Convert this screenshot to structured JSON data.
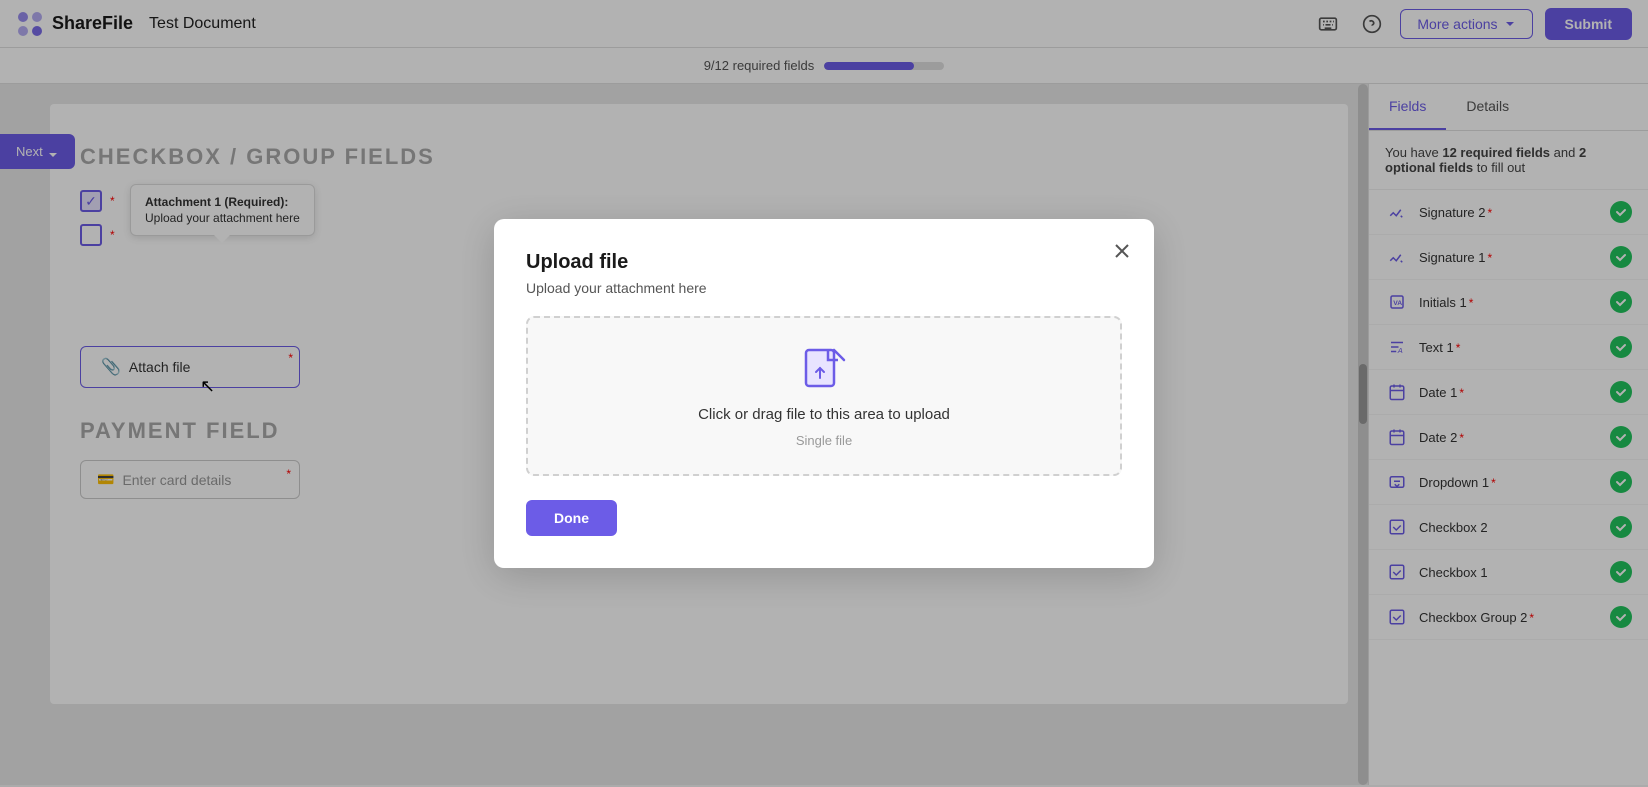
{
  "header": {
    "logo_text": "ShareFile",
    "doc_title": "Test Document",
    "more_actions_label": "More actions",
    "submit_label": "Submit"
  },
  "progress": {
    "text": "9/12 required fields",
    "percent": 75
  },
  "document": {
    "section_title": "CHECKBOX / GROUP FIELDS",
    "next_button_label": "Next",
    "tooltip_title": "Attachment 1 (Required):",
    "tooltip_body": "Upload your attachment here",
    "attach_file_label": "Attach file",
    "payment_section_title": "PAYMENT FIELD",
    "card_input_placeholder": "Enter card details"
  },
  "right_panel": {
    "tab_fields": "Fields",
    "tab_details": "Details",
    "info_text_prefix": "You have ",
    "required_count": "12 required fields",
    "info_text_middle": " and ",
    "optional_count": "2 optional fields",
    "info_text_suffix": " to fill out",
    "fields": [
      {
        "id": "signature2",
        "icon": "✏",
        "name": "Signature 2",
        "required": true,
        "done": true
      },
      {
        "id": "signature1",
        "icon": "✏",
        "name": "Signature 1",
        "required": true,
        "done": true
      },
      {
        "id": "initials1",
        "icon": "VA",
        "name": "Initials 1",
        "required": true,
        "done": true
      },
      {
        "id": "text1",
        "icon": "A",
        "name": "Text 1",
        "required": true,
        "done": true
      },
      {
        "id": "date1",
        "icon": "📅",
        "name": "Date 1",
        "required": true,
        "done": true
      },
      {
        "id": "date2",
        "icon": "📅",
        "name": "Date 2",
        "required": true,
        "done": true
      },
      {
        "id": "dropdown1",
        "icon": "☰",
        "name": "Dropdown 1",
        "required": true,
        "done": true
      },
      {
        "id": "checkbox2",
        "icon": "☑",
        "name": "Checkbox 2",
        "required": false,
        "done": true
      },
      {
        "id": "checkbox1",
        "icon": "☑",
        "name": "Checkbox 1",
        "required": false,
        "done": true
      },
      {
        "id": "checkboxgroup2",
        "icon": "☑",
        "name": "Checkbox Group 2",
        "required": true,
        "done": true
      }
    ]
  },
  "modal": {
    "title": "Upload file",
    "subtitle": "Upload your attachment here",
    "upload_text": "Click or drag file to this area to upload",
    "upload_subtext": "Single file",
    "done_label": "Done"
  }
}
